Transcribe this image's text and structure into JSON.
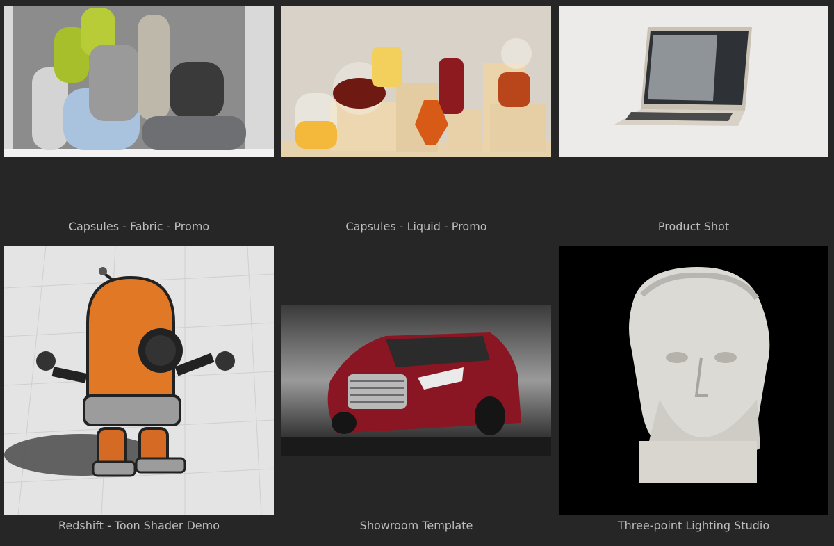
{
  "gallery": {
    "items": [
      {
        "title": "Capsules - Fabric - Promo",
        "thumb_icon": "fabric-capsules-render"
      },
      {
        "title": "Capsules - Liquid - Promo",
        "thumb_icon": "liquid-glassware-render"
      },
      {
        "title": "Product Shot",
        "thumb_icon": "laptop-product-render"
      },
      {
        "title": "Redshift - Toon Shader Demo",
        "thumb_icon": "toon-robot-render"
      },
      {
        "title": "Showroom Template",
        "thumb_icon": "red-car-render"
      },
      {
        "title": "Three-point Lighting Studio",
        "thumb_icon": "marble-bust-render"
      }
    ]
  },
  "colors": {
    "background": "#262626",
    "caption": "#bdbdbd"
  }
}
